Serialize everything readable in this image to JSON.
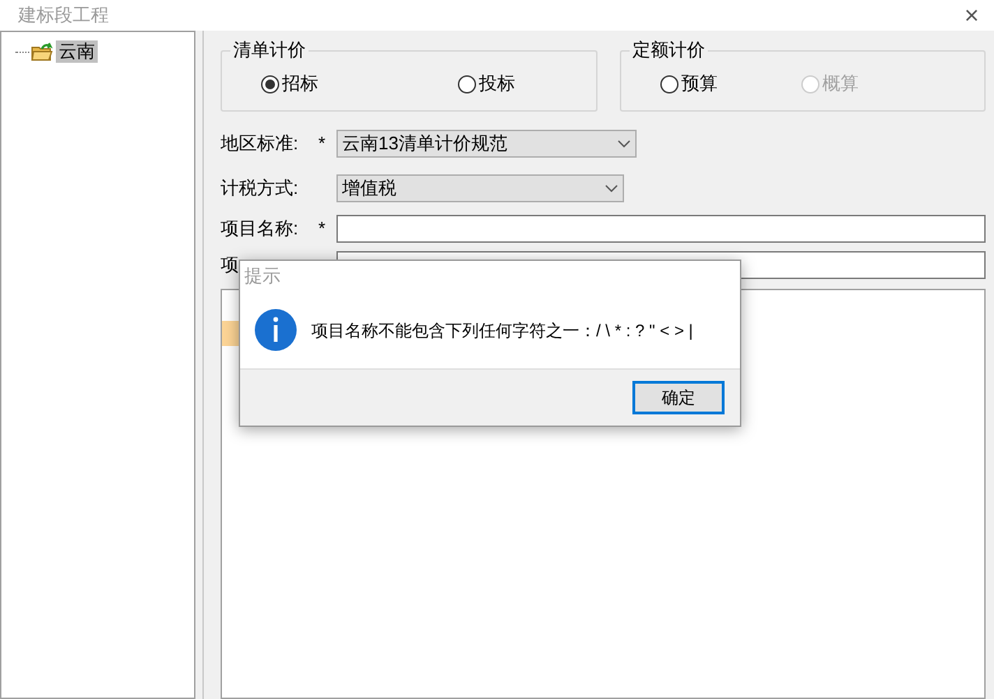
{
  "window": {
    "title": "建标段工程",
    "close": "×"
  },
  "tree": {
    "items": [
      {
        "label": "云南",
        "selected": true
      }
    ]
  },
  "groups": [
    {
      "title": "清单计价",
      "options": [
        {
          "label": "招标",
          "selected": true,
          "disabled": false
        },
        {
          "label": "投标",
          "selected": false,
          "disabled": false
        }
      ]
    },
    {
      "title": "定额计价",
      "options": [
        {
          "label": "预算",
          "selected": false,
          "disabled": false
        },
        {
          "label": "概算",
          "selected": false,
          "disabled": true
        }
      ]
    }
  ],
  "fields": [
    {
      "kind": "dropdown",
      "label": "地区标准:",
      "mark": "*",
      "value": "云南13清单计价规范"
    },
    {
      "kind": "dropdown",
      "label": "计税方式:",
      "value": "增值税"
    },
    {
      "kind": "input",
      "label": "项目名称:",
      "mark": "*"
    },
    {
      "kind": "input",
      "label": "项"
    }
  ],
  "dialog": {
    "title": "提示",
    "message": "项目名称不能包含下列任何字符之一：/ \\ * : ? \" < > |",
    "button": "确定"
  }
}
